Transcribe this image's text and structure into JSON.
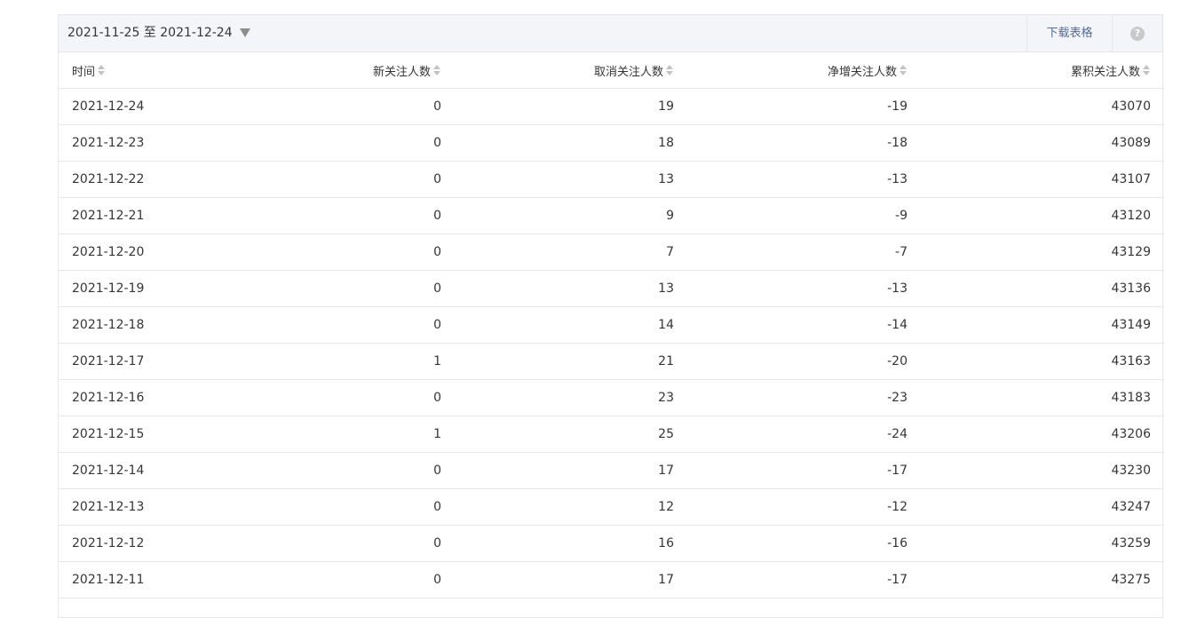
{
  "toolbar": {
    "date_range": "2021-11-25 至 2021-12-24",
    "download_label": "下载表格",
    "help_label": "?"
  },
  "table": {
    "columns": [
      "时间",
      "新关注人数",
      "取消关注人数",
      "净增关注人数",
      "累积关注人数"
    ],
    "rows": [
      [
        "2021-12-24",
        "0",
        "19",
        "-19",
        "43070"
      ],
      [
        "2021-12-23",
        "0",
        "18",
        "-18",
        "43089"
      ],
      [
        "2021-12-22",
        "0",
        "13",
        "-13",
        "43107"
      ],
      [
        "2021-12-21",
        "0",
        "9",
        "-9",
        "43120"
      ],
      [
        "2021-12-20",
        "0",
        "7",
        "-7",
        "43129"
      ],
      [
        "2021-12-19",
        "0",
        "13",
        "-13",
        "43136"
      ],
      [
        "2021-12-18",
        "0",
        "14",
        "-14",
        "43149"
      ],
      [
        "2021-12-17",
        "1",
        "21",
        "-20",
        "43163"
      ],
      [
        "2021-12-16",
        "0",
        "23",
        "-23",
        "43183"
      ],
      [
        "2021-12-15",
        "1",
        "25",
        "-24",
        "43206"
      ],
      [
        "2021-12-14",
        "0",
        "17",
        "-17",
        "43230"
      ],
      [
        "2021-12-13",
        "0",
        "12",
        "-12",
        "43247"
      ],
      [
        "2021-12-12",
        "0",
        "16",
        "-16",
        "43259"
      ],
      [
        "2021-12-11",
        "0",
        "17",
        "-17",
        "43275"
      ]
    ]
  },
  "colors": {
    "link": "#576b95",
    "border": "#e7e7eb",
    "toolbar_bg": "#f4f5f9",
    "text": "#353535"
  }
}
